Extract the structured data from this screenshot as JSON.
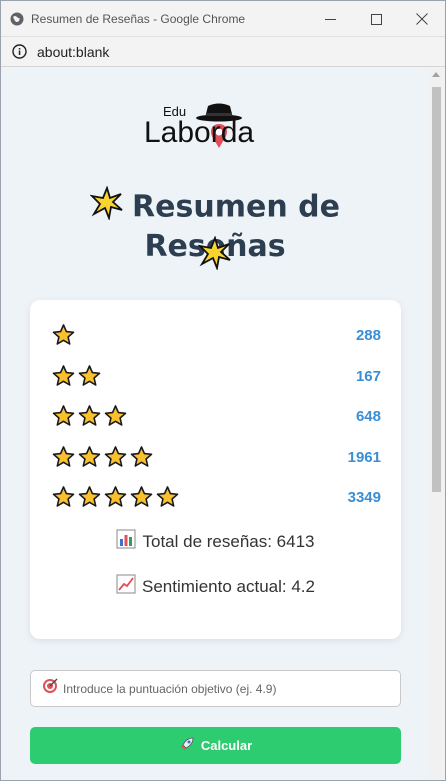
{
  "window": {
    "title": "Resumen de Reseñas - Google Chrome",
    "controls": [
      "minimize",
      "maximize",
      "close"
    ]
  },
  "address_bar": {
    "url": "about:blank"
  },
  "logo": {
    "text_small": "Edu",
    "text_large": "Laborda"
  },
  "heading": {
    "title": "Resumen de Reseñas"
  },
  "ratings": [
    {
      "stars": 1,
      "count": "288"
    },
    {
      "stars": 2,
      "count": "167"
    },
    {
      "stars": 3,
      "count": "648"
    },
    {
      "stars": 4,
      "count": "1961"
    },
    {
      "stars": 5,
      "count": "3349"
    }
  ],
  "stats": {
    "total_label": "Total de reseñas: 6413",
    "sentiment_label": "Sentimiento actual: 4.2"
  },
  "target_input": {
    "placeholder": "Introduce la puntuación objetivo (ej. 4.9)",
    "value": ""
  },
  "calculate_button": {
    "label": "Calcular"
  },
  "colors": {
    "accent_blue": "#3a8ed6",
    "button_green": "#2ecc71",
    "heading": "#2c3e50",
    "star_fill": "#f9c12e",
    "background": "#eef3f8"
  }
}
